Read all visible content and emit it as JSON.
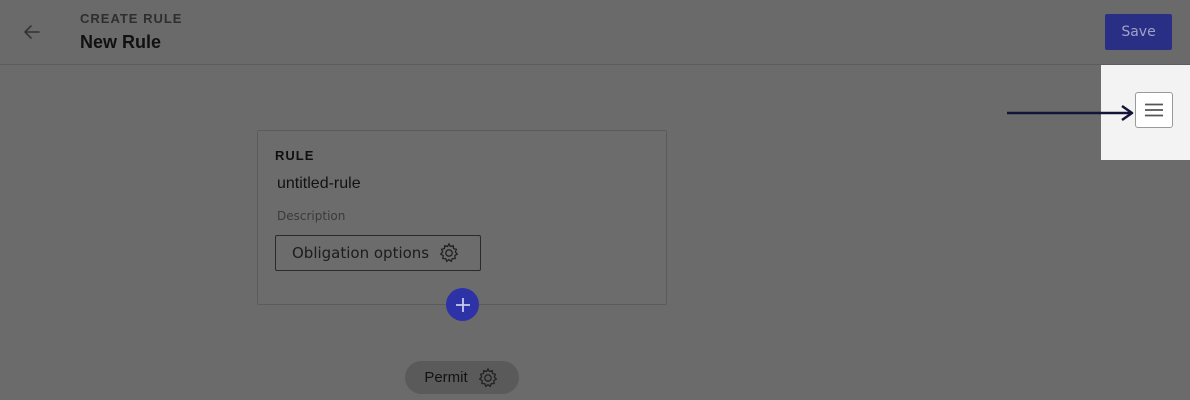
{
  "header": {
    "back_icon": "arrow-left-icon",
    "kicker": "CREATE RULE",
    "title": "New Rule",
    "save_label": "Save"
  },
  "side_menu": {
    "icon": "hamburger-menu-icon"
  },
  "annotation": {
    "icon": "arrow-right-icon"
  },
  "rule_card": {
    "heading": "RULE",
    "name": "untitled-rule",
    "description_placeholder": "Description",
    "obligation_label": "Obligation options",
    "obligation_icon": "gear-icon"
  },
  "add_button": {
    "icon": "plus-icon"
  },
  "effect": {
    "label": "Permit",
    "icon": "gear-icon"
  },
  "colors": {
    "overlay": "#6b6b6b",
    "primary": "#2a2f86",
    "add_button": "#2d32a6",
    "highlight_panel": "#f3f3f3"
  }
}
